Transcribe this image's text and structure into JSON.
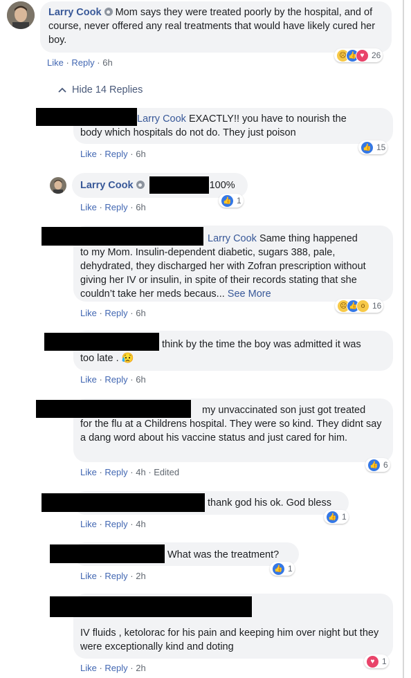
{
  "main_comment": {
    "author": "Larry Cook",
    "text": "Mom says they were treated poorly by the hospital, and of course, never offered any real treatments that would have likely cured her boy.",
    "like": "Like",
    "reply": "Reply",
    "time": "6h",
    "reaction_count": "26"
  },
  "hide_replies": "Hide 14 Replies",
  "replies": [
    {
      "mention": "Larry Cook",
      "text_line1": " EXACTLY!! you have to nourish the",
      "text_line2": "body which hospitals do not do. They just poison",
      "like": "Like",
      "reply": "Reply",
      "time": "6h",
      "reaction_count": "15"
    },
    {
      "author": "Larry Cook",
      "text": "100%",
      "like": "Like",
      "reply": "Reply",
      "time": "6h",
      "reaction_count": "1"
    },
    {
      "mention": "Larry Cook",
      "text_line1": " Same thing happened",
      "text_rest": "to my Mom. Insulin-dependent diabetic, sugars 388, pale, dehydrated, they discharged her with Zofran prescription without giving her IV or insulin, in spite of their records stating that she couldn’t take her meds becaus...",
      "see_more": "See More",
      "like": "Like",
      "reply": "Reply",
      "time": "6h",
      "reaction_count": "16"
    },
    {
      "text_line1": "think by the time the boy was admitted it was",
      "text_line2": "too late .",
      "emoji": "😥",
      "like": "Like",
      "reply": "Reply",
      "time": "6h"
    },
    {
      "text_line1": "my unvaccinated son just got treated",
      "text_rest": "for the flu at a Childrens hospital. They were so kind. They didnt say a dang word about his vaccine status and just cared for him.",
      "like": "Like",
      "reply": "Reply",
      "time": "4h",
      "edited": "Edited",
      "reaction_count": "6"
    },
    {
      "text": "thank god his ok. God bless",
      "like": "Like",
      "reply": "Reply",
      "time": "4h",
      "reaction_count": "1"
    },
    {
      "text": "What was the treatment?",
      "like": "Like",
      "reply": "Reply",
      "time": "2h",
      "reaction_count": "1"
    },
    {
      "text": "IV fluids , ketolorac for his pain and keeping him over night but they were exceptionally kind and doting",
      "like": "Like",
      "reply": "Reply",
      "time": "2h",
      "reaction_count": "1"
    }
  ],
  "icons": {
    "like": "thumbs-up-icon",
    "love": "heart-icon",
    "sad": "sad-face-icon",
    "wow": "wow-face-icon",
    "collapse": "chevron-up-icon"
  },
  "colors": {
    "name": "#385898",
    "like_reaction": "#3578e5",
    "love_reaction": "#e9446a",
    "bubble": "#f2f3f5"
  }
}
